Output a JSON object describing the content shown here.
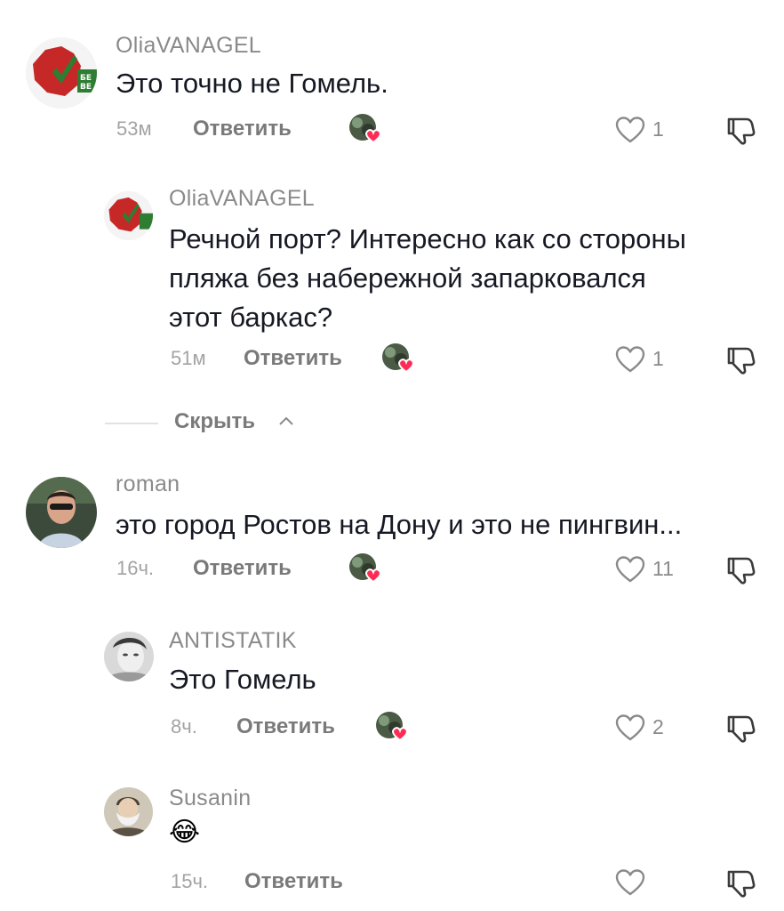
{
  "comments": [
    {
      "username": "OliaVANAGEL",
      "text_lines": [
        "Это точно не Гомель."
      ],
      "time": "53м",
      "reply_label": "Ответить",
      "likes": "1"
    },
    {
      "username": "OliaVANAGEL",
      "text_lines": [
        "Речной порт? Интересно как со стороны",
        "пляжа без набережной запарковался",
        "этот баркас?"
      ],
      "time": "51м",
      "reply_label": "Ответить",
      "likes": "1"
    },
    {
      "username": "roman",
      "text_lines": [
        "это город Ростов на Дону и это не пингвин..."
      ],
      "time": "16ч.",
      "reply_label": "Ответить",
      "likes": "11"
    },
    {
      "username": "ANTISTATIK",
      "text_lines": [
        "Это Гомель"
      ],
      "time": "8ч.",
      "reply_label": "Ответить",
      "likes": "2"
    },
    {
      "username": "Susanin",
      "text_lines": [
        "😂"
      ],
      "time": "15ч.",
      "reply_label": "Ответить",
      "likes": ""
    }
  ],
  "hide_replies_label": "Скрыть",
  "icons": {
    "like": "heart-outline-icon",
    "dislike": "thumbs-down-icon",
    "hide": "chevron-up-icon",
    "creator_like": "creator-liked-avatar"
  },
  "colors": {
    "username": "#8a8a8a",
    "text": "#161823",
    "meta": "#a3a3a3",
    "creator_heart": "#fe2c55"
  }
}
